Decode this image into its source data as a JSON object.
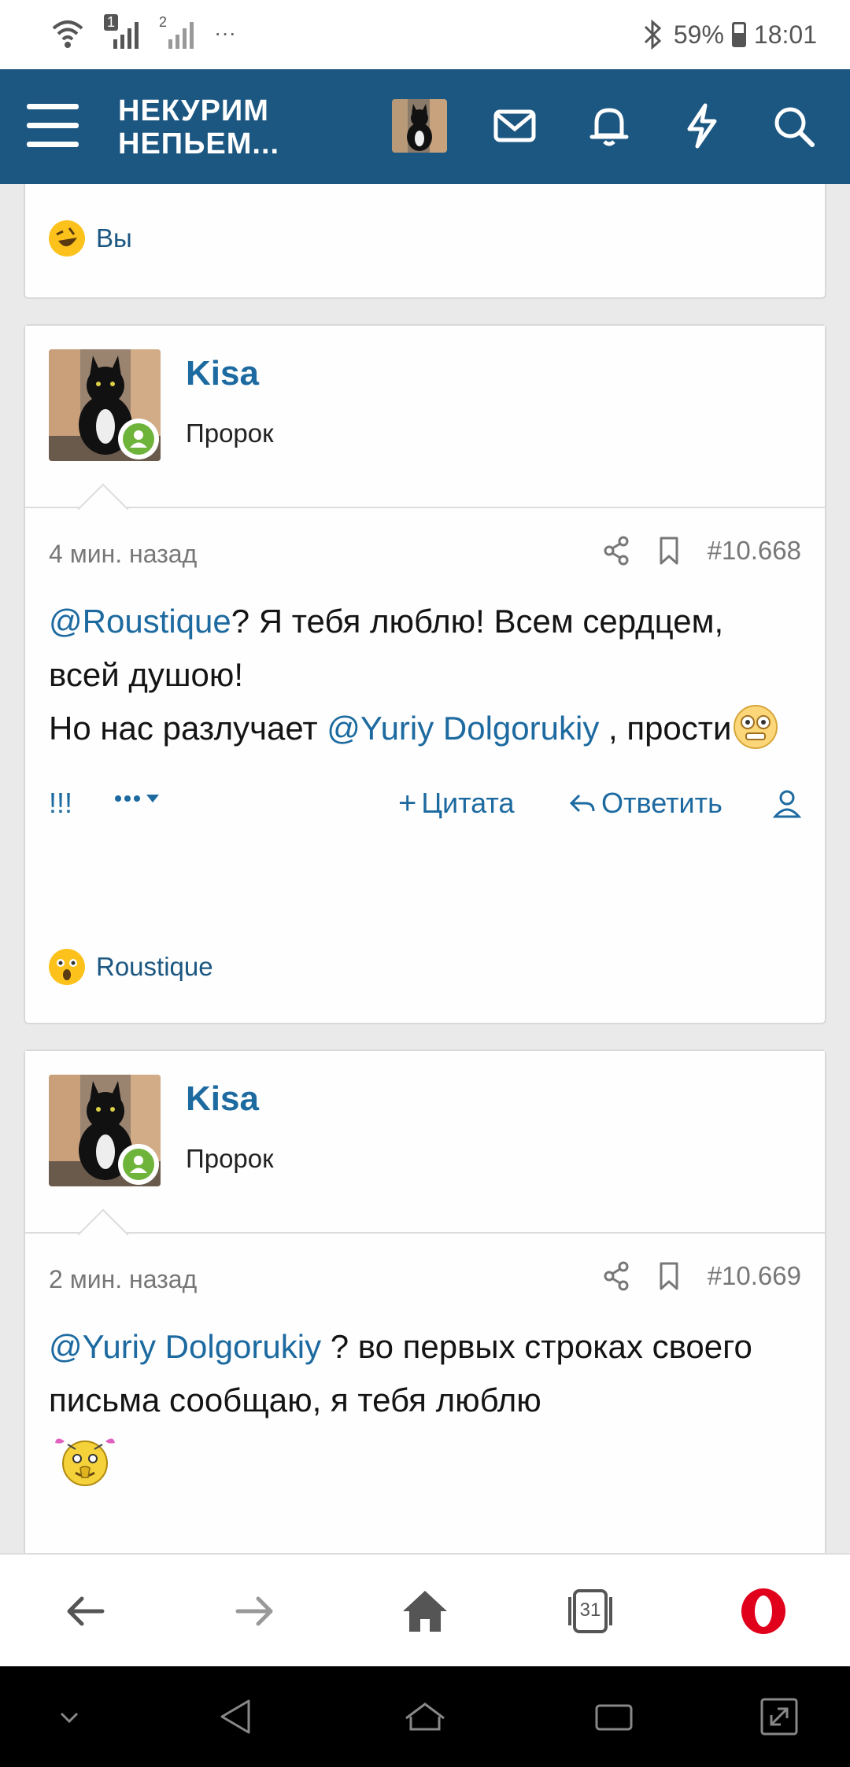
{
  "status": {
    "sim1": "1",
    "sim2": "2",
    "dots": "···",
    "battery": "59%",
    "time": "18:01",
    "battery_level": 0.59
  },
  "header": {
    "logo_line1": "НЕКУРИМ",
    "logo_line2": "НЕПЬЕМ..."
  },
  "card0": {
    "reaction_name": "Вы"
  },
  "post1": {
    "username": "Kisa",
    "user_title": "Пророк",
    "time": "4 мин. назад",
    "number": "#10.668",
    "mention1": "@Roustique",
    "text1": "? Я тебя люблю! Всем сердцем, всей душою!",
    "text2": "Но нас разлучает ",
    "mention2": "@Yuriy Dolgorukiy",
    "text3": " , прости",
    "report": "!!!",
    "quote": "Цитата",
    "reply": "Ответить",
    "reaction_name": "Roustique"
  },
  "post2": {
    "username": "Kisa",
    "user_title": "Пророк",
    "time": "2 мин. назад",
    "number": "#10.669",
    "mention1": "@Yuriy Dolgorukiy",
    "text1": " ? во первых строках своего письма сообщаю, я тебя люблю"
  },
  "browser": {
    "tabs_count": "31"
  },
  "colors": {
    "header": "#1c5782",
    "link": "#1c6aa0",
    "online": "#6fb43a",
    "opera": "#e0001b"
  }
}
